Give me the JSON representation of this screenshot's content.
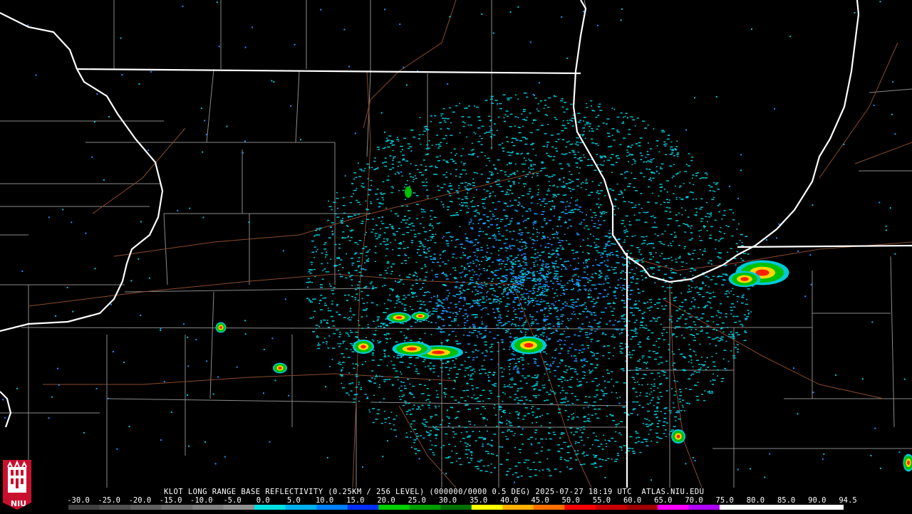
{
  "header": {
    "caption": "KLOT LONG RANGE BASE REFLECTIVITY (0.25KM / 256 LEVEL) (000000/0000 0.5 DEG) 2025-07-27 18:19 UTC  ATLAS.NIU.EDU"
  },
  "colorbar": {
    "labels": [
      "-30.0",
      "-25.0",
      "-20.0",
      "-15.0",
      "-10.0",
      "-5.0",
      "0.0",
      "5.0",
      "10.0",
      "15.0",
      "20.0",
      "25.0",
      "30.0",
      "35.0",
      "40.0",
      "45.0",
      "50.0",
      "55.0",
      "60.0",
      "65.0",
      "70.0",
      "75.0",
      "80.0",
      "85.0",
      "90.0",
      "94.5"
    ],
    "colors": [
      "#404040",
      "#505050",
      "#606060",
      "#707070",
      "#808080",
      "#909090",
      "#00e0e0",
      "#00b0f0",
      "#0080ff",
      "#0030ff",
      "#00d000",
      "#00a000",
      "#007000",
      "#ffff00",
      "#ffb000",
      "#ff7000",
      "#ff0000",
      "#c80000",
      "#a00000",
      "#ff00ff",
      "#b000ff",
      "#ffffff",
      "#ffffff",
      "#ffffff",
      "#ffffff"
    ]
  },
  "logo": {
    "text": "NIU",
    "colors": {
      "red": "#c8102e",
      "white": "#ffffff"
    }
  },
  "map": {
    "colors": {
      "background": "#000000",
      "state_lines": "#ffffff",
      "county_lines": "#8a8a8a",
      "roads": "#8b4a2b",
      "echo_light": "#00c8d8",
      "echo_mid": "#2090ff",
      "echo_green": "#00c000",
      "echo_yellow": "#ffd800",
      "echo_red": "#ff2000"
    }
  }
}
